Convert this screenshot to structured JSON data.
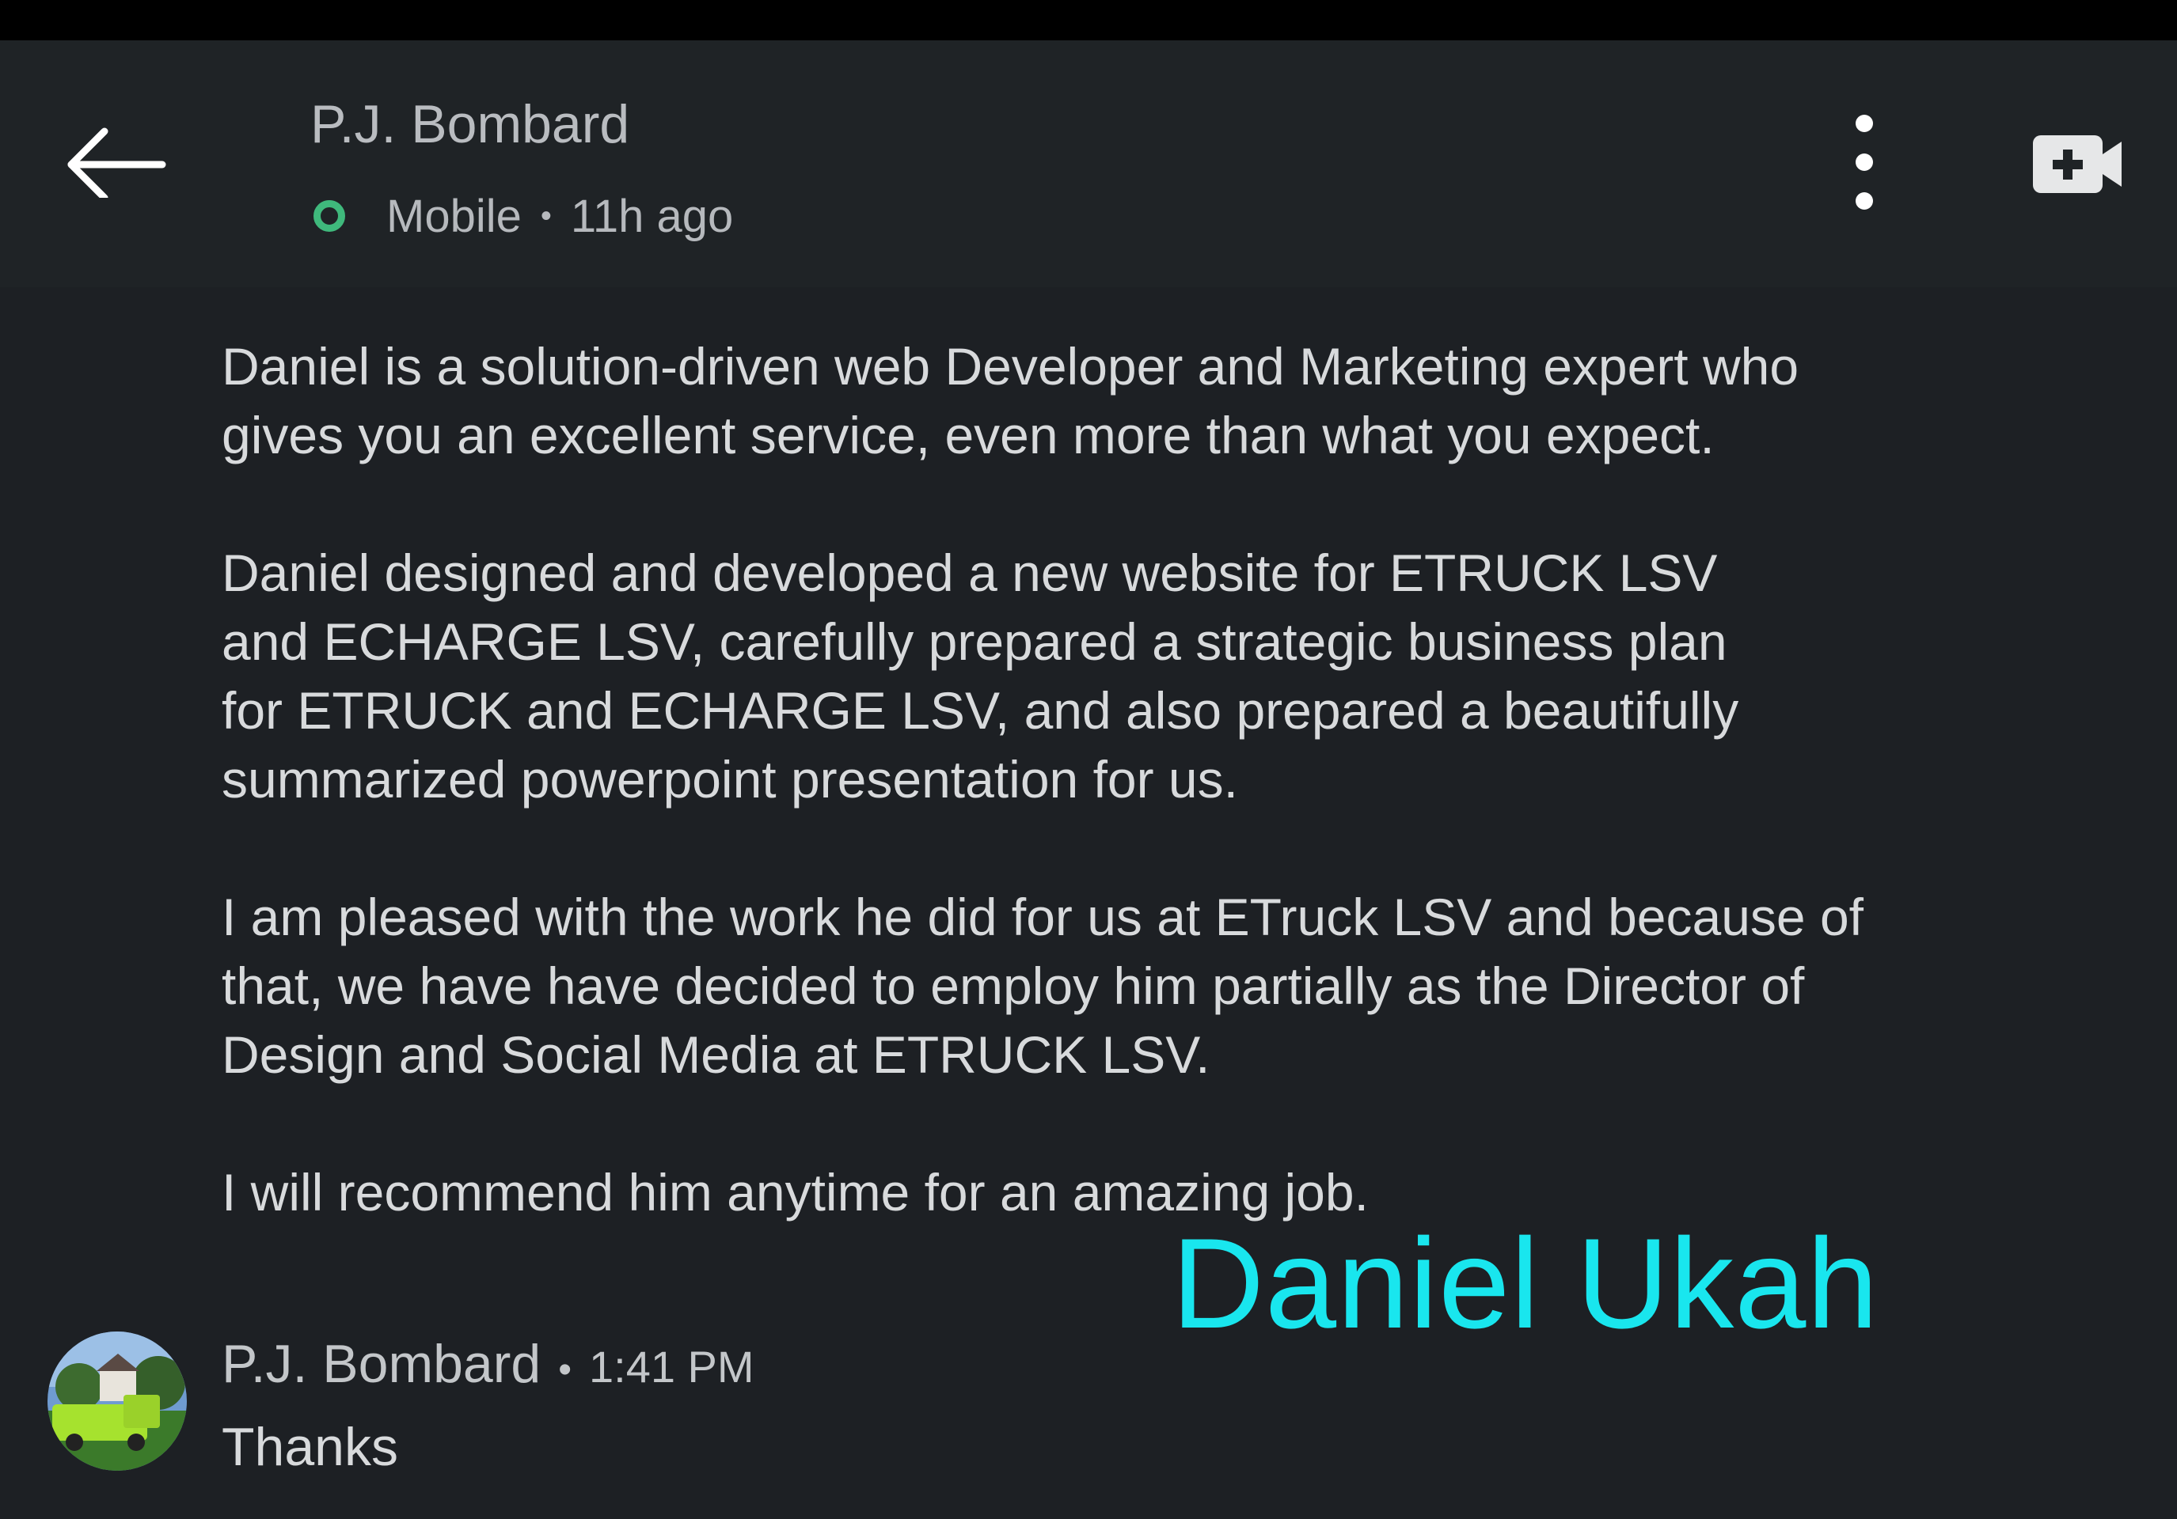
{
  "header": {
    "contact_name": "P.J. Bombard",
    "presence_status": "Mobile",
    "separator": "•",
    "last_seen": "11h ago",
    "presence_color": "#3fb97c",
    "icons": [
      "arrow-left-icon",
      "more-vertical-icon",
      "video-call-add-icon"
    ]
  },
  "message": {
    "paragraphs": [
      [
        "Daniel is a solution-driven web Developer and Marketing expert who",
        "gives you an excellent service, even more than what you expect."
      ],
      [
        "Daniel designed and developed a new website for ETRUCK LSV",
        "and ECHARGE LSV, carefully prepared a strategic business plan",
        "for ETRUCK and ECHARGE LSV, and also prepared a beautifully",
        "summarized powerpoint presentation for us."
      ],
      [
        "I am pleased with the work he did for us at ETruck LSV and because of",
        "that, we have have decided to employ him partially as the Director of",
        "Design and Social Media at ETRUCK LSV."
      ],
      [
        "I will recommend him anytime for an amazing job."
      ]
    ]
  },
  "watermark": {
    "text": "Daniel Ukah",
    "color": "#19e6ee"
  },
  "reply": {
    "author": "P.J. Bombard",
    "separator": "•",
    "time": "1:41 PM",
    "text": "Thanks"
  }
}
